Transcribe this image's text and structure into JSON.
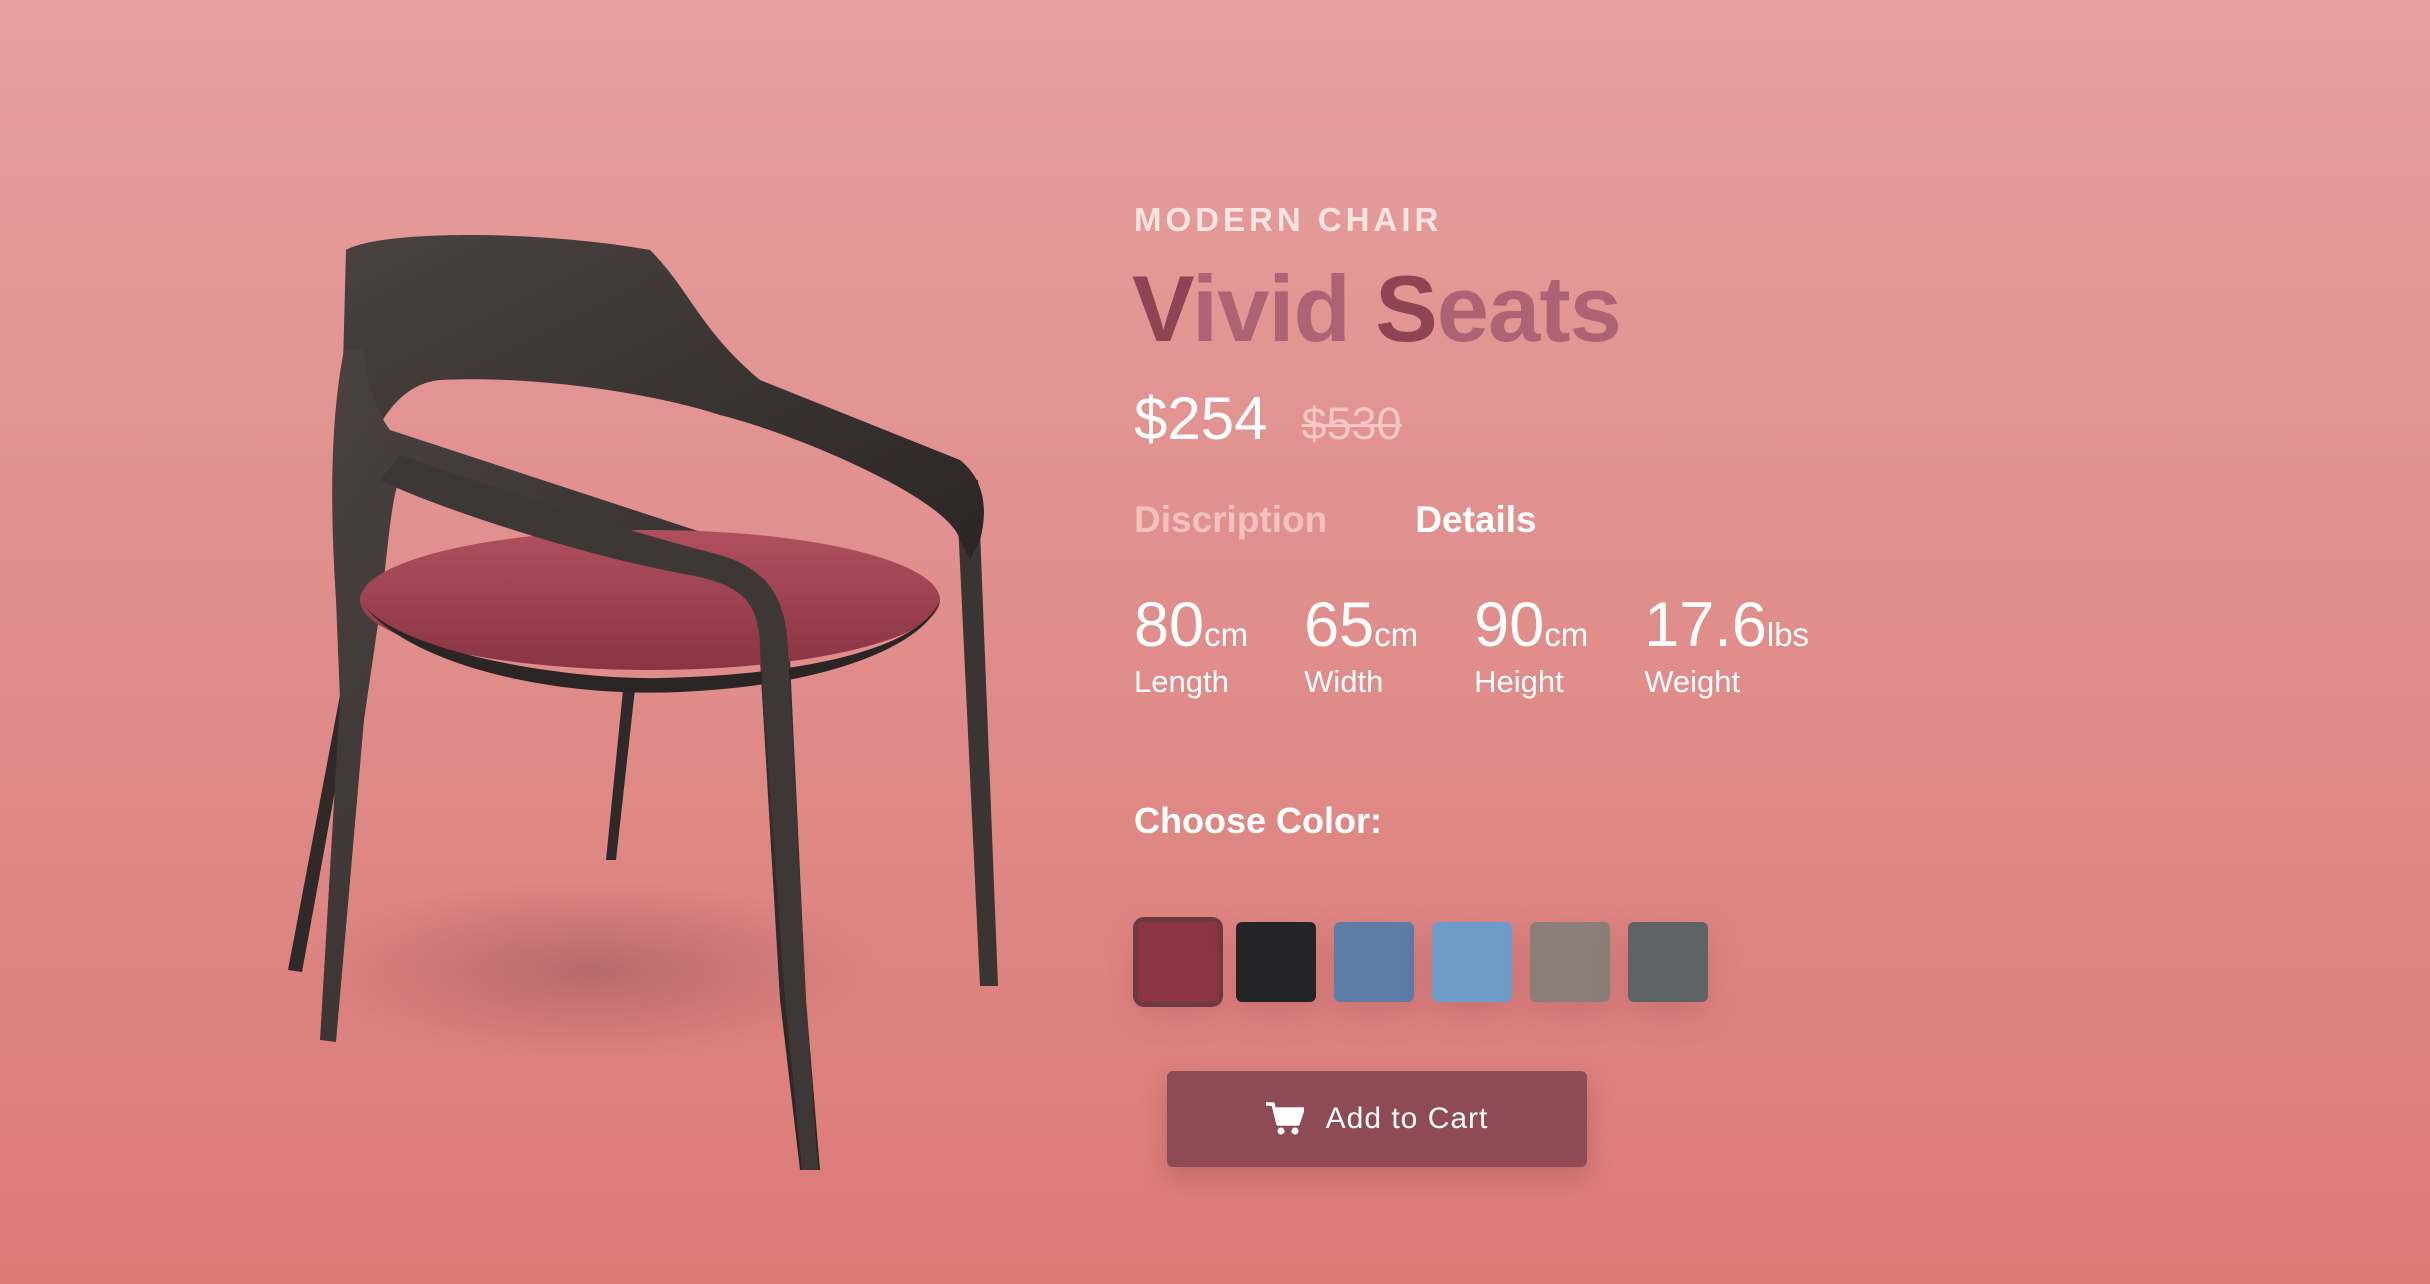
{
  "product": {
    "category": "MODERN CHAIR",
    "title_part1": "Vivid",
    "title_part2": "Seats",
    "price": "$254",
    "old_price": "$530",
    "image_icon": "chair-photo"
  },
  "tabs": [
    {
      "label": "Discription",
      "active": false
    },
    {
      "label": "Details",
      "active": true
    }
  ],
  "specs": [
    {
      "value": "80",
      "unit": "cm",
      "label": "Length"
    },
    {
      "value": "65",
      "unit": "cm",
      "label": "Width"
    },
    {
      "value": "90",
      "unit": "cm",
      "label": "Height"
    },
    {
      "value": "17.6",
      "unit": "lbs",
      "label": "Weight"
    }
  ],
  "colors": {
    "label": "Choose Color:",
    "swatches": [
      {
        "name": "red-fabric",
        "color": "#8c3444",
        "selected": true
      },
      {
        "name": "black-fabric",
        "color": "#242426",
        "selected": false
      },
      {
        "name": "blue-velvet",
        "color": "#5d7ca6",
        "selected": false
      },
      {
        "name": "light-blue-fabric",
        "color": "#6f9cc9",
        "selected": false
      },
      {
        "name": "taupe-fabric",
        "color": "#8a7f78",
        "selected": false
      },
      {
        "name": "grey-fabric",
        "color": "#5d6463",
        "selected": false
      }
    ]
  },
  "cart": {
    "label": "Add to Cart",
    "icon": "cart-icon"
  },
  "theme": {
    "background": "#e08f8d",
    "accent": "#8e4b56"
  }
}
